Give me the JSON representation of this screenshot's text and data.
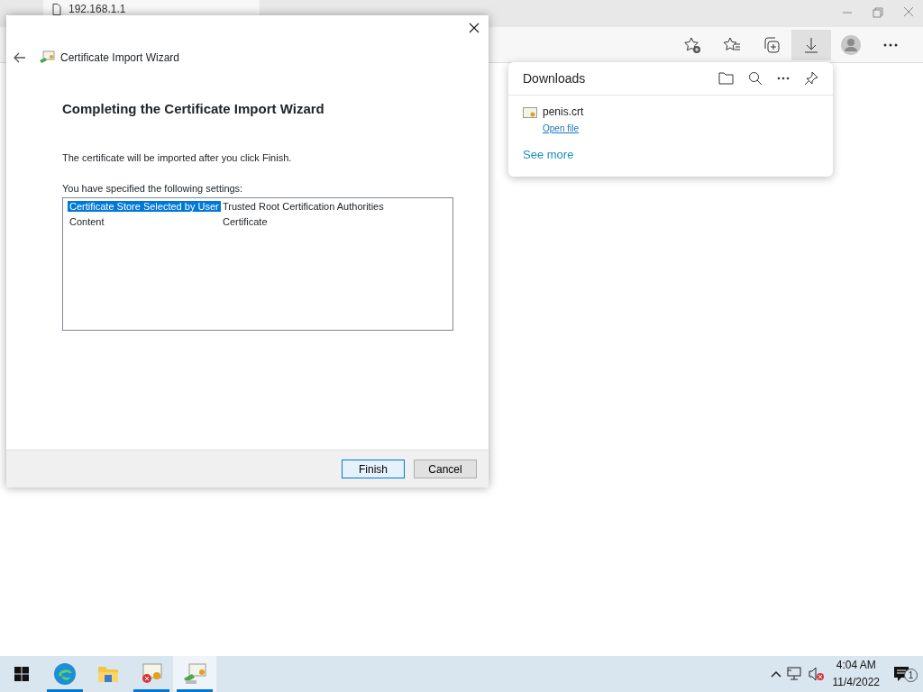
{
  "browser": {
    "tab_title": "192.168.1.1"
  },
  "downloads": {
    "title": "Downloads",
    "items": [
      {
        "name": "penis.crt",
        "action": "Open file"
      }
    ],
    "see_more": "See more"
  },
  "dialog": {
    "title": "Certificate Import Wizard",
    "heading": "Completing the Certificate Import Wizard",
    "message": "The certificate will be imported after you click Finish.",
    "settings_label": "You have specified the following settings:",
    "settings": [
      {
        "setting": "Certificate Store Selected by User",
        "value": "Trusted Root Certification Authorities",
        "selected": true
      },
      {
        "setting": "Content",
        "value": "Certificate",
        "selected": false
      }
    ],
    "buttons": [
      {
        "label": "Finish",
        "kind": "primary"
      },
      {
        "label": "Cancel",
        "kind": "secondary"
      }
    ]
  },
  "taskbar": {
    "apps": [
      {
        "kind": "edge",
        "running": true,
        "selected": false
      },
      {
        "kind": "folder",
        "running": false,
        "selected": false
      },
      {
        "kind": "cert-error",
        "running": true,
        "selected": false
      },
      {
        "kind": "wizard",
        "running": true,
        "selected": true
      }
    ],
    "time": "4:04 AM",
    "date": "11/4/2022",
    "notifications": "1"
  }
}
